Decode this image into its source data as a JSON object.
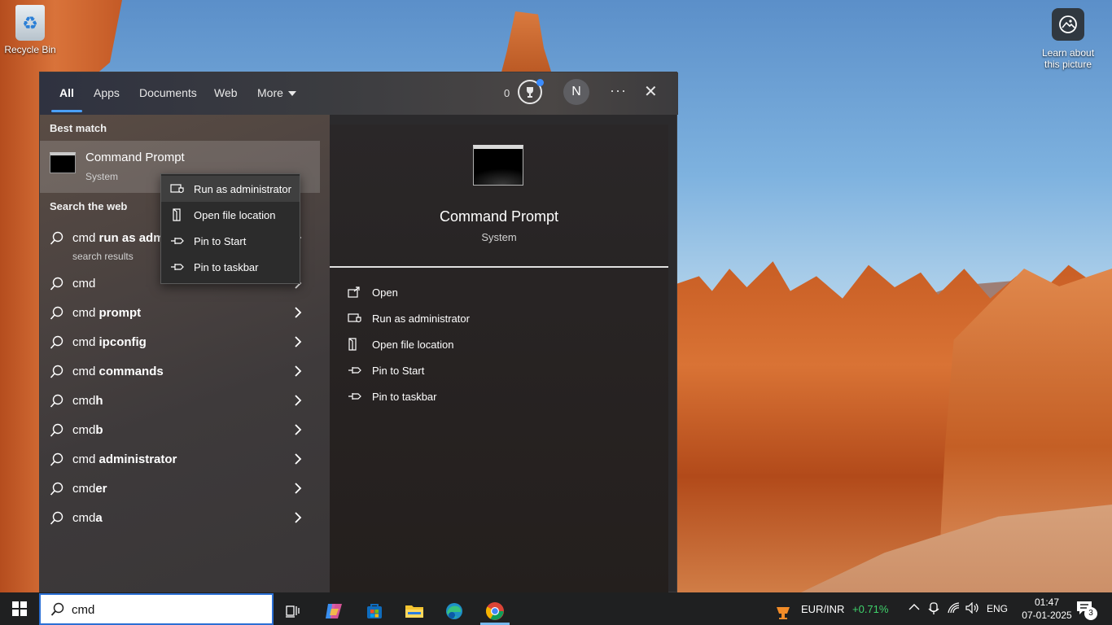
{
  "desktop": {
    "recycle_bin_label": "Recycle Bin",
    "learn_label_line1": "Learn about",
    "learn_label_line2": "this picture"
  },
  "search_panel": {
    "tabs": [
      {
        "label": "All",
        "active": true
      },
      {
        "label": "Apps"
      },
      {
        "label": "Documents"
      },
      {
        "label": "Web"
      },
      {
        "label": "More"
      }
    ],
    "rewards_points": "0",
    "avatar_initial": "N",
    "more_options": "···",
    "close_glyph": "✕",
    "best_match_heading": "Best match",
    "best_match": {
      "title": "Command Prompt",
      "subtitle": "System"
    },
    "search_web_heading": "Search the web",
    "web_results": [
      {
        "prefix": "cmd ",
        "bold": "run as adm",
        "sub": "search results"
      },
      {
        "prefix": "cmd",
        "bold": ""
      },
      {
        "prefix": "cmd ",
        "bold": "prompt"
      },
      {
        "prefix": "cmd ",
        "bold": "ipconfig"
      },
      {
        "prefix": "cmd ",
        "bold": "commands"
      },
      {
        "prefix": "cmd",
        "bold": "h"
      },
      {
        "prefix": "cmd",
        "bold": "b"
      },
      {
        "prefix": "cmd ",
        "bold": "administrator"
      },
      {
        "prefix": "cmd",
        "bold": "er"
      },
      {
        "prefix": "cmd",
        "bold": "a"
      }
    ],
    "context_menu": [
      {
        "label": "Run as administrator",
        "icon": "shield-icon"
      },
      {
        "label": "Open file location",
        "icon": "file-location-icon"
      },
      {
        "label": "Pin to Start",
        "icon": "pin-icon"
      },
      {
        "label": "Pin to taskbar",
        "icon": "pin-icon"
      }
    ],
    "detail": {
      "title": "Command Prompt",
      "subtitle": "System",
      "actions": [
        {
          "label": "Open",
          "icon": "open-icon"
        },
        {
          "label": "Run as administrator",
          "icon": "shield-icon"
        },
        {
          "label": "Open file location",
          "icon": "file-location-icon"
        },
        {
          "label": "Pin to Start",
          "icon": "pin-icon"
        },
        {
          "label": "Pin to taskbar",
          "icon": "pin-icon"
        }
      ]
    }
  },
  "taskbar": {
    "search_value": "cmd",
    "ticker_pair": "EUR/INR",
    "ticker_change": "+0.71%",
    "language": "ENG",
    "time": "01:47",
    "date": "07-01-2025",
    "notification_count": "3",
    "colors": {
      "accent": "#2b6fd4",
      "positive": "#3fd26b"
    }
  }
}
